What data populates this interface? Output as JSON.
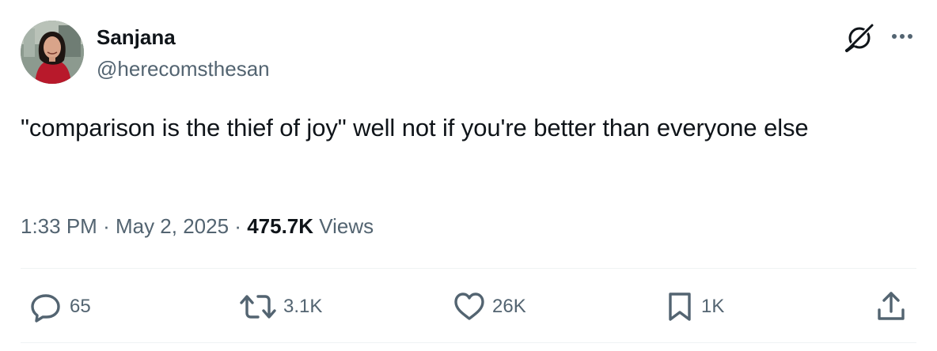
{
  "author": {
    "name": "Sanjana",
    "handle": "@herecomsthesan"
  },
  "tweet": {
    "text": "\"comparison is the thief of joy\" well not if you're better than everyone else"
  },
  "meta": {
    "time": "1:33 PM",
    "separator1": "·",
    "date": "May 2, 2025",
    "separator2": "·",
    "views_count": "475.7K",
    "views_label": "Views"
  },
  "actions": {
    "replies": "65",
    "reposts": "3.1K",
    "likes": "26K",
    "bookmarks": "1K"
  },
  "icons": {
    "grok": "grok-icon",
    "more": "more-horizontal-icon",
    "reply": "reply-icon",
    "repost": "repost-icon",
    "like": "heart-icon",
    "bookmark": "bookmark-icon",
    "share": "share-icon"
  },
  "colors": {
    "text_primary": "#0f1419",
    "text_secondary": "#536471",
    "divider": "#eff3f4"
  }
}
